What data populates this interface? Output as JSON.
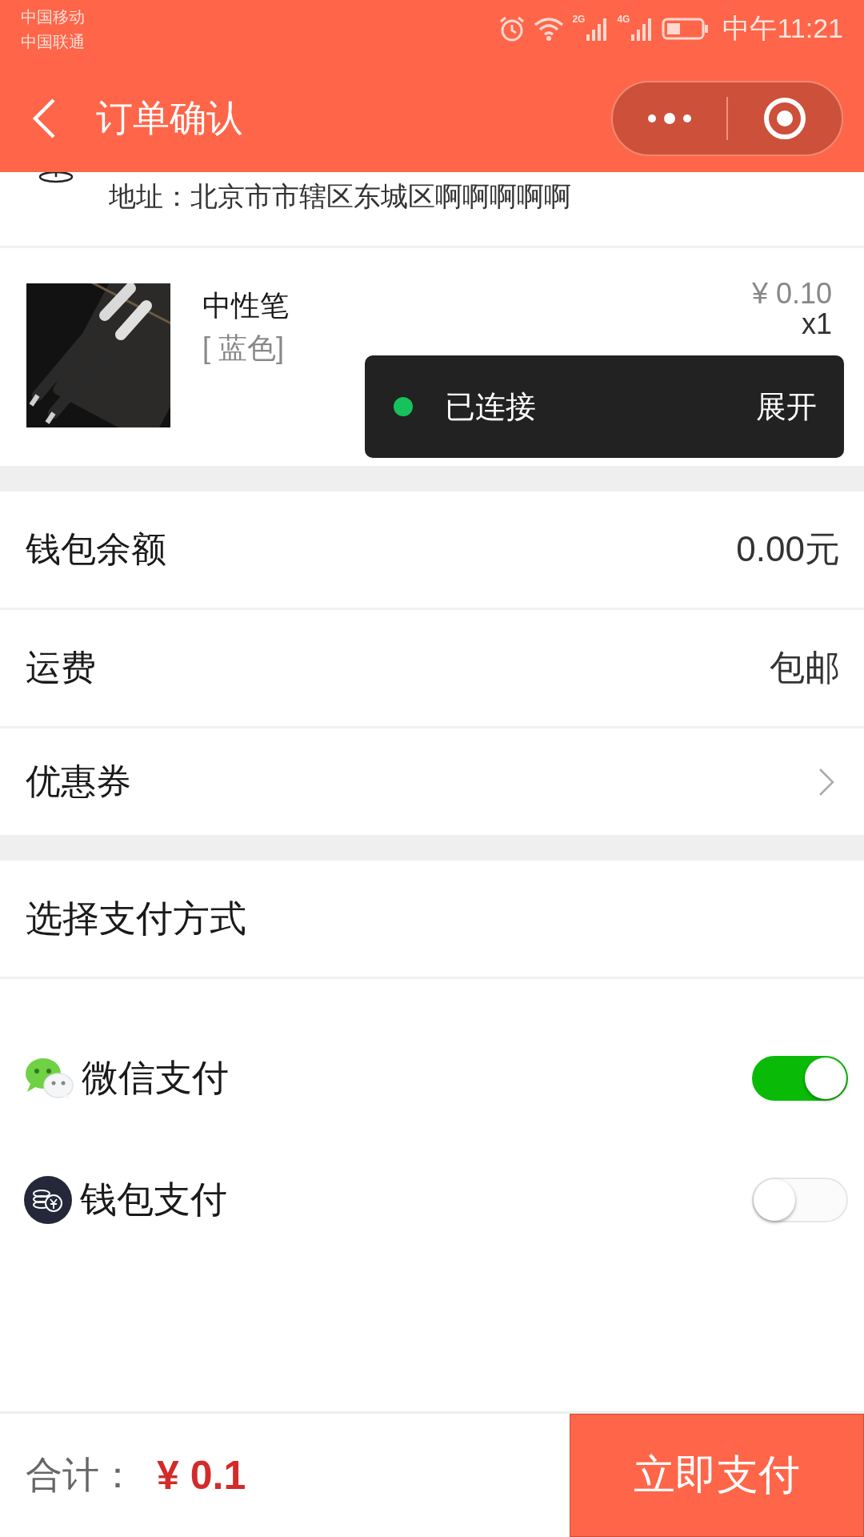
{
  "status_bar": {
    "carriers": [
      "中国移动",
      "中国联通"
    ],
    "network_labels": [
      "2G",
      "4G"
    ],
    "time": "中午11:21"
  },
  "nav": {
    "title": "订单确认"
  },
  "address": {
    "text": "地址：北京市市辖区东城区啊啊啊啊啊"
  },
  "product": {
    "name": "中性笔",
    "variant": "[ 蓝色]",
    "price": "¥ 0.10",
    "quantity": "x1"
  },
  "toast": {
    "text": "已连接",
    "action": "展开",
    "connected": true
  },
  "info_rows": [
    {
      "label": "钱包余额",
      "value": "0.00元",
      "kind": "text"
    },
    {
      "label": "运费",
      "value": "包邮",
      "kind": "text"
    },
    {
      "label": "优惠券",
      "kind": "link"
    }
  ],
  "payment": {
    "title": "选择支付方式",
    "methods": [
      {
        "label": "微信支付",
        "kind": "wechat",
        "on": true
      },
      {
        "label": "钱包支付",
        "kind": "wallet",
        "on": false
      }
    ]
  },
  "footer": {
    "total_label": "合计：",
    "total": "¥ 0.1",
    "pay_button": "立即支付"
  }
}
